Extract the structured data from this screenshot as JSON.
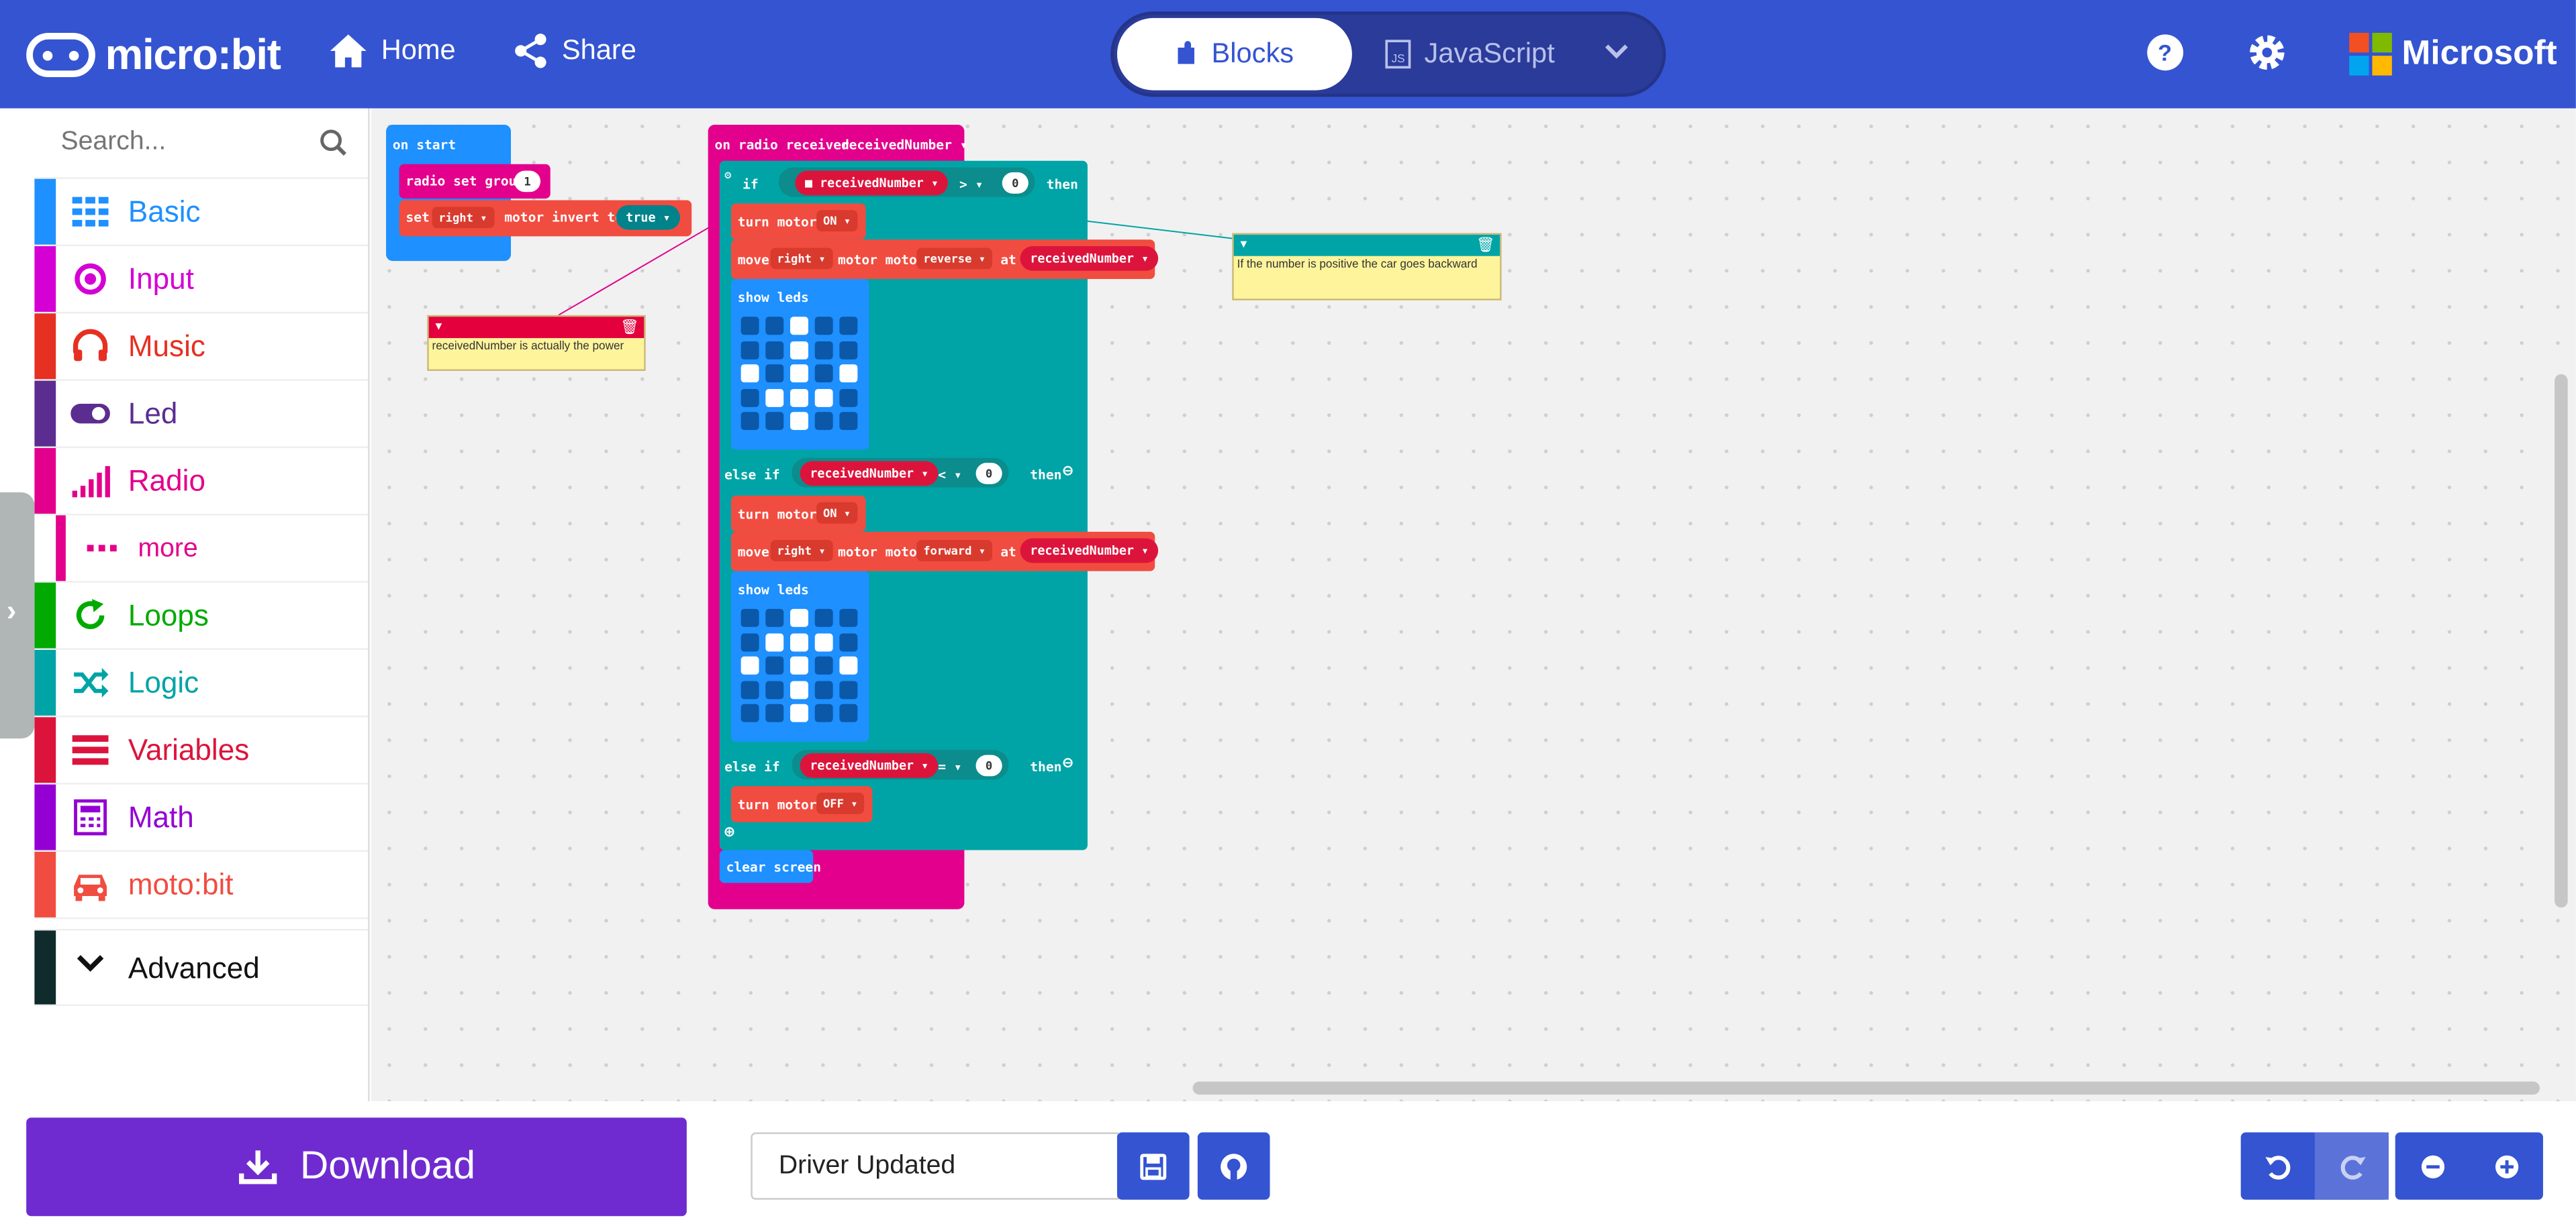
{
  "header": {
    "logo_text": "micro:bit",
    "home": "Home",
    "share": "Share",
    "tab_blocks": "Blocks",
    "tab_js": "JavaScript",
    "brand": "Microsoft"
  },
  "toolbox": {
    "search_placeholder": "Search...",
    "categories": [
      {
        "label": "Basic",
        "color": "#1E90FF",
        "icon": "grid-icon"
      },
      {
        "label": "Input",
        "color": "#D400D4",
        "icon": "target-icon"
      },
      {
        "label": "Music",
        "color": "#E63022",
        "icon": "headphones-icon"
      },
      {
        "label": "Led",
        "color": "#5C2D91",
        "icon": "toggle-icon"
      },
      {
        "label": "Radio",
        "color": "#E3008C",
        "icon": "signal-bars-icon"
      },
      {
        "label": "more",
        "color": "#E3008C",
        "icon": "ellipsis-icon"
      },
      {
        "label": "Loops",
        "color": "#00AA00",
        "icon": "refresh-icon"
      },
      {
        "label": "Logic",
        "color": "#00A4A6",
        "icon": "shuffle-icon"
      },
      {
        "label": "Variables",
        "color": "#DC143C",
        "icon": "list-icon"
      },
      {
        "label": "Math",
        "color": "#9400D3",
        "icon": "calculator-icon"
      },
      {
        "label": "moto:bit",
        "color": "#F14C40",
        "icon": "car-icon"
      }
    ],
    "advanced": "Advanced"
  },
  "workspace": {
    "on_start": "on start",
    "radio_set_group": "radio set group",
    "group_value": "1",
    "set_label": "set",
    "right_opt": "right",
    "motor_invert": "motor invert to",
    "true_opt": "true",
    "on_radio_received": "on radio received",
    "received_number": "receivedNumber",
    "if_label": "if",
    "then_label": "then",
    "else_if": "else if",
    "op_gt": ">",
    "op_lt": "<",
    "op_eq": "=",
    "zero": "0",
    "turn_motors": "turn motors",
    "on_opt": "ON",
    "off_opt": "OFF",
    "move": "move",
    "motor_motor": "motor motor",
    "reverse": "reverse",
    "forward": "forward",
    "at": "at",
    "show_leds": "show leds",
    "clear_screen": "clear screen",
    "comment1": "receivedNumber is actually the power",
    "comment2": "If the number is positive the car goes backward",
    "leds1": [
      0,
      0,
      1,
      0,
      0,
      0,
      0,
      1,
      0,
      0,
      1,
      0,
      1,
      0,
      1,
      0,
      1,
      1,
      1,
      0,
      0,
      0,
      1,
      0,
      0
    ],
    "leds2": [
      0,
      0,
      1,
      0,
      0,
      0,
      1,
      1,
      1,
      0,
      1,
      0,
      1,
      0,
      1,
      0,
      0,
      1,
      0,
      0,
      0,
      0,
      1,
      0,
      0
    ]
  },
  "footer": {
    "download": "Download",
    "project_name": "Driver Updated"
  },
  "colors": {
    "header": "#3454D1",
    "download": "#6F2BD0",
    "radio": "#E3008C",
    "logic": "#00A4A6",
    "motobit": "#F14C40",
    "variables": "#DC143C",
    "basic": "#1E90FF"
  }
}
